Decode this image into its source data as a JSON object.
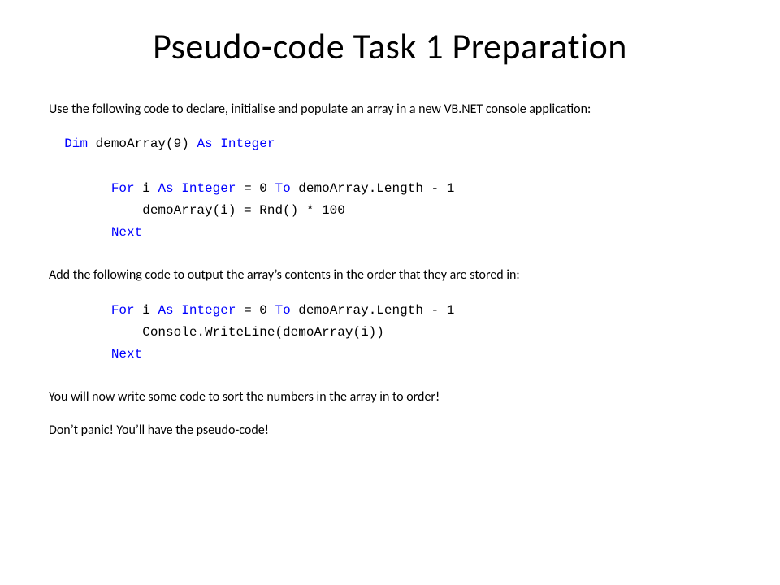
{
  "title": "Pseudo-code Task 1 Preparation",
  "para1": "Use the following code to declare, initialise and populate an array in a new VB.NET console application:",
  "code1": {
    "line1_pre": "  ",
    "line1_dim": "Dim",
    "line1_mid": " demoArray(9) ",
    "line1_as": "As",
    "line1_space": " ",
    "line1_integer": "Integer",
    "line2_pre": "        ",
    "line2_for": "For",
    "line2_a": " i ",
    "line2_as": "As",
    "line2_b": " ",
    "line2_integer": "Integer",
    "line2_c": " = 0 ",
    "line2_to": "To",
    "line2_d": " demoArray.Length - 1",
    "line3": "            demoArray(i) = Rnd() * 100",
    "line4_pre": "        ",
    "line4_next": "Next"
  },
  "para2": "Add the following code to output the array’s contents in the order that they are stored in:",
  "code2": {
    "line1_pre": "        ",
    "line1_for": "For",
    "line1_a": " i ",
    "line1_as": "As",
    "line1_b": " ",
    "line1_integer": "Integer",
    "line1_c": " = 0 ",
    "line1_to": "To",
    "line1_d": " demoArray.Length - 1",
    "line2": "            Console.WriteLine(demoArray(i))",
    "line3_pre": "        ",
    "line3_next": "Next"
  },
  "para3": "You will now write some code to sort the numbers in the array in to order!",
  "para4": "Don’t panic! You’ll have the pseudo-code!"
}
